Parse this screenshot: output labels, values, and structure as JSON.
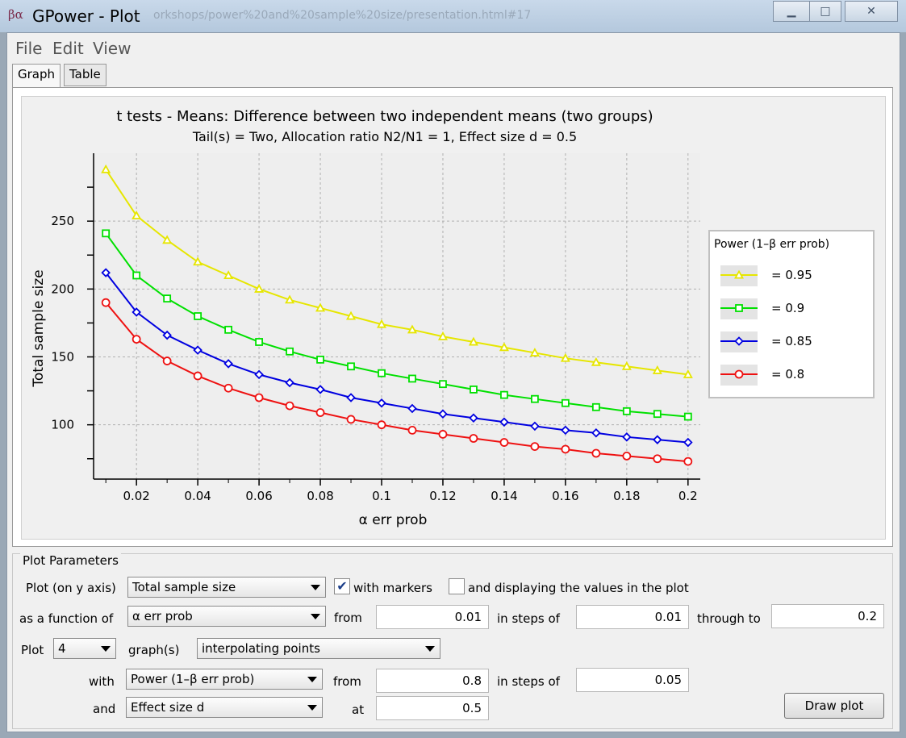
{
  "window": {
    "title": "GPower - Plot",
    "background_title": "orkshops/power%20and%20sample%20size/presentation.html#17",
    "icon_glyph": "βα",
    "minimize": "▁",
    "maximize": "□",
    "close": "✕"
  },
  "menu": [
    {
      "label": "File"
    },
    {
      "label": "Edit"
    },
    {
      "label": "View"
    }
  ],
  "tabs": [
    {
      "label": "Graph",
      "active": true
    },
    {
      "label": "Table",
      "active": false
    }
  ],
  "chart_data": {
    "type": "line",
    "title": "t tests - Means: Difference between two independent means (two groups)",
    "subtitle": "Tail(s) = Two, Allocation ratio N2/N1 = 1, Effect size d = 0.5",
    "xlabel": "α err prob",
    "ylabel": "Total sample size",
    "xlim": [
      0.006,
      0.204
    ],
    "ylim": [
      60,
      300
    ],
    "xticks": [
      0.02,
      0.04,
      0.06,
      0.08,
      0.1,
      0.12,
      0.14,
      0.16,
      0.18,
      0.2
    ],
    "xtick_labels": [
      "0.02",
      "0.04",
      "0.06",
      "0.08",
      "0.1",
      "0.12",
      "0.14",
      "0.16",
      "0.18",
      "0.2"
    ],
    "yticks": [
      100,
      150,
      200,
      250
    ],
    "yticks_minor": [
      75,
      125,
      175,
      225,
      275
    ],
    "grid": true,
    "legend": {
      "title": "Power (1–β err prob)",
      "placement": "right"
    },
    "x": [
      0.01,
      0.02,
      0.03,
      0.04,
      0.05,
      0.06,
      0.07,
      0.08,
      0.09,
      0.1,
      0.11,
      0.12,
      0.13,
      0.14,
      0.15,
      0.16,
      0.17,
      0.18,
      0.19,
      0.2
    ],
    "series": [
      {
        "name": "= 0.95",
        "color": "#e6e600",
        "marker": "triangle",
        "values": [
          288,
          254,
          236,
          220,
          210,
          200,
          192,
          186,
          180,
          174,
          170,
          165,
          161,
          157,
          153,
          149,
          146,
          143,
          140,
          137
        ]
      },
      {
        "name": "= 0.9",
        "color": "#00e000",
        "marker": "square",
        "values": [
          241,
          210,
          193,
          180,
          170,
          161,
          154,
          148,
          143,
          138,
          134,
          130,
          126,
          122,
          119,
          116,
          113,
          110,
          108,
          106
        ]
      },
      {
        "name": "= 0.85",
        "color": "#0000e0",
        "marker": "diamond",
        "values": [
          212,
          183,
          166,
          155,
          145,
          137,
          131,
          126,
          120,
          116,
          112,
          108,
          105,
          102,
          99,
          96,
          94,
          91,
          89,
          87
        ]
      },
      {
        "name": "= 0.8",
        "color": "#ee1111",
        "marker": "circle",
        "values": [
          190,
          163,
          147,
          136,
          127,
          120,
          114,
          109,
          104,
          100,
          96,
          93,
          90,
          87,
          84,
          82,
          79,
          77,
          75,
          73
        ]
      }
    ]
  },
  "params": {
    "section_title": "Plot Parameters",
    "y_axis_label": "Plot (on y axis)",
    "y_axis_value": "Total sample size",
    "with_markers_label": "with markers",
    "with_markers_checked": true,
    "display_values_label": "and displaying the values in the plot",
    "display_values_checked": false,
    "function_of_label": "as a function of",
    "function_of_value": "α err prob",
    "from_label": "from",
    "from_value": "0.01",
    "steps_label": "in steps of",
    "steps_value": "0.01",
    "through_label": "through to",
    "through_value": "0.2",
    "plot_label": "Plot",
    "plot_count": "4",
    "graphs_label": "graph(s)",
    "interp_value": "interpolating points",
    "with_label": "with",
    "with_value": "Power (1–β err prob)",
    "with_from_label": "from",
    "with_from_value": "0.8",
    "with_steps_label": "in steps of",
    "with_steps_value": "0.05",
    "and_label": "and",
    "and_value": "Effect size d",
    "at_label": "at",
    "at_value": "0.5",
    "draw_button": "Draw plot"
  }
}
